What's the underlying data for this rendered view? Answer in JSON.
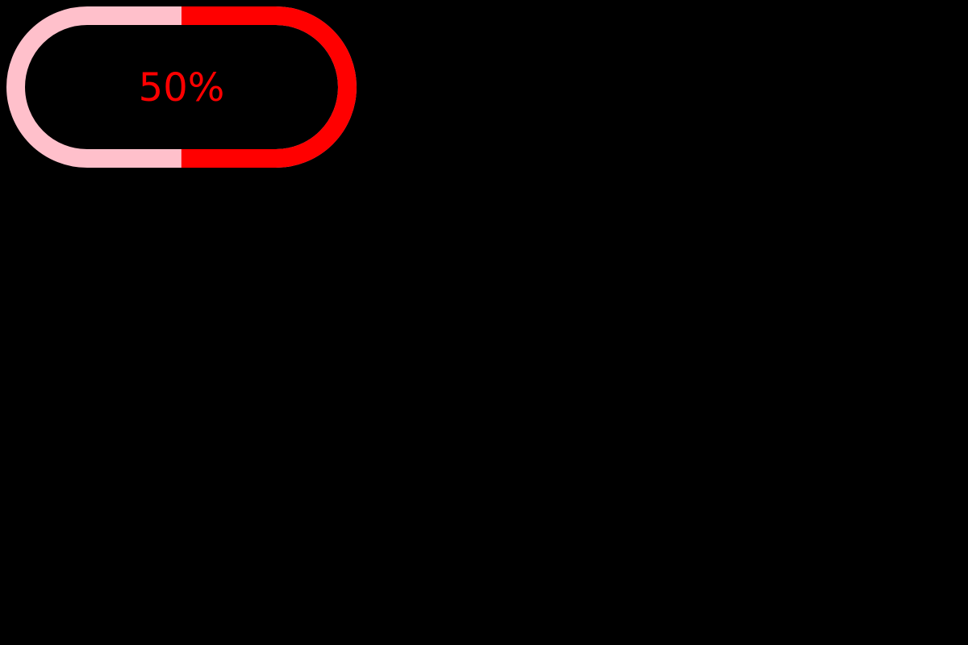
{
  "progress": {
    "label": "50%",
    "value": 0.5
  },
  "colors": {
    "background": "#000000",
    "track": "#ffc0cb",
    "fill": "#ff0000",
    "label": "#ff0000"
  }
}
